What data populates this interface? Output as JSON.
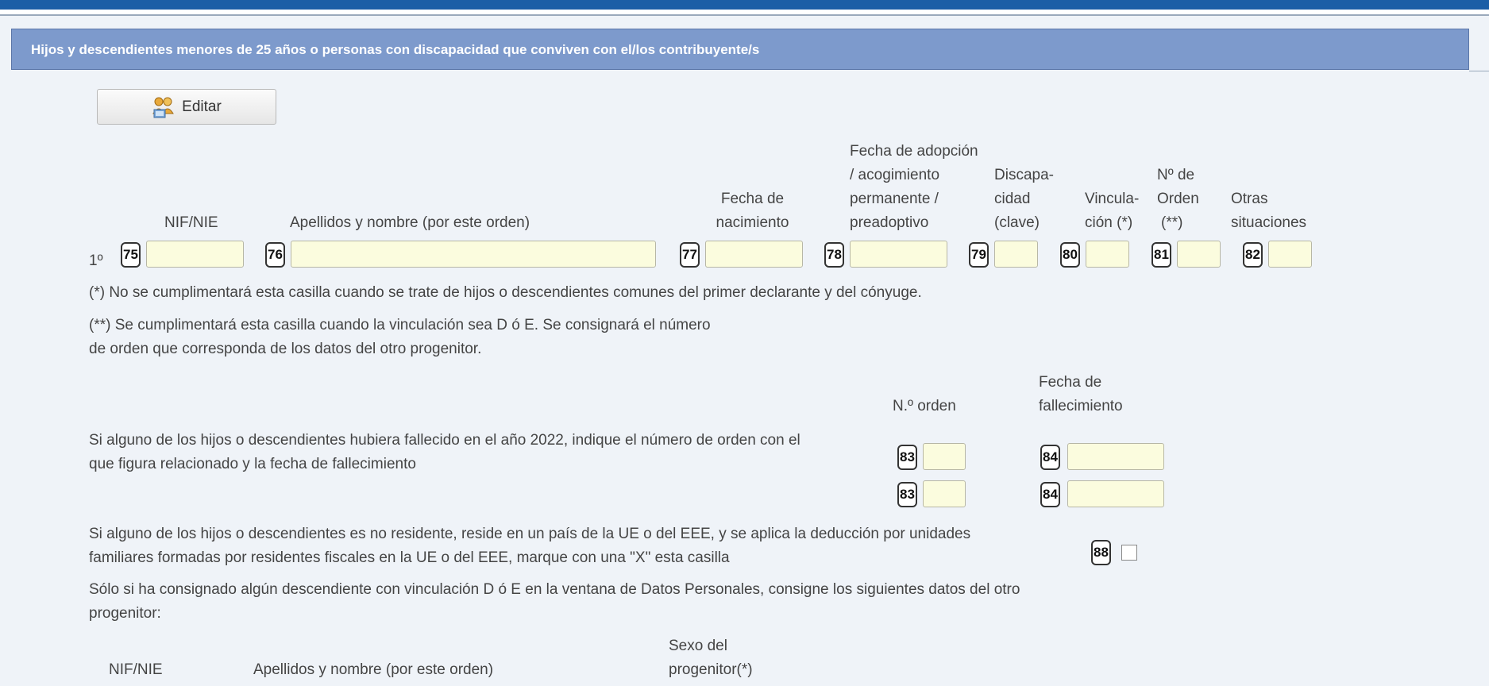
{
  "section": {
    "title": "Hijos y descendientes menores de 25 años o personas con discapacidad que conviven con el/los contribuyente/s"
  },
  "edit_button": {
    "label": "Editar",
    "icon": "people-edit-icon"
  },
  "table": {
    "columns": {
      "nif": "NIF/NIE",
      "name": "Apellidos y nombre (por este orden)",
      "birth": [
        "Fecha de",
        "nacimiento"
      ],
      "adoption": [
        "Fecha de adopción",
        "/ acogimiento",
        "permanente /",
        "preadoptivo"
      ],
      "disability": [
        "Discapa-",
        "cidad",
        "(clave)"
      ],
      "link": [
        "Vincula-",
        "ción (*)"
      ],
      "order": [
        "Nº de",
        "Orden",
        "(**)"
      ],
      "other": [
        "Otras",
        "situaciones"
      ]
    },
    "row_label": "1º",
    "boxes": [
      "75",
      "76",
      "77",
      "78",
      "79",
      "80",
      "81",
      "82"
    ]
  },
  "notes": {
    "note1": "(*) No se cumplimentará esta casilla cuando se trate de hijos o descendientes comunes del primer declarante y del cónyuge.",
    "note2_line1": "(**) Se cumplimentará esta casilla cuando la vinculación sea D ó E. Se consignará el número",
    "note2_line2": "de orden que corresponda de los datos del otro progenitor."
  },
  "deceased": {
    "col_order": "N.º orden",
    "col_date": [
      "Fecha de",
      "fallecimiento"
    ],
    "text_line1": "Si alguno de los hijos o descendientes hubiera fallecido en el año 2022, indique el número de orden con el",
    "text_line2": "que figura relacionado y la fecha de fallecimiento",
    "box_order": "83",
    "box_date": "84"
  },
  "nonresident": {
    "text_line1": "Si alguno de los hijos o descendientes es no residente, reside en un país de la UE o del EEE, y se aplica la deducción por unidades",
    "text_line2": "familiares formadas por residentes fiscales en la UE o del EEE, marque con una \"X\" esta casilla",
    "box": "88"
  },
  "other_parent": {
    "text_line1": "Sólo si ha consignado algún descendiente con vinculación D ó E en la ventana de Datos Personales, consigne los siguientes datos del otro",
    "text_line2": "progenitor:",
    "col_nif": "NIF/NIE",
    "col_name": "Apellidos y nombre (por este orden)",
    "col_sex": [
      "Sexo del",
      "progenitor(*)"
    ]
  }
}
